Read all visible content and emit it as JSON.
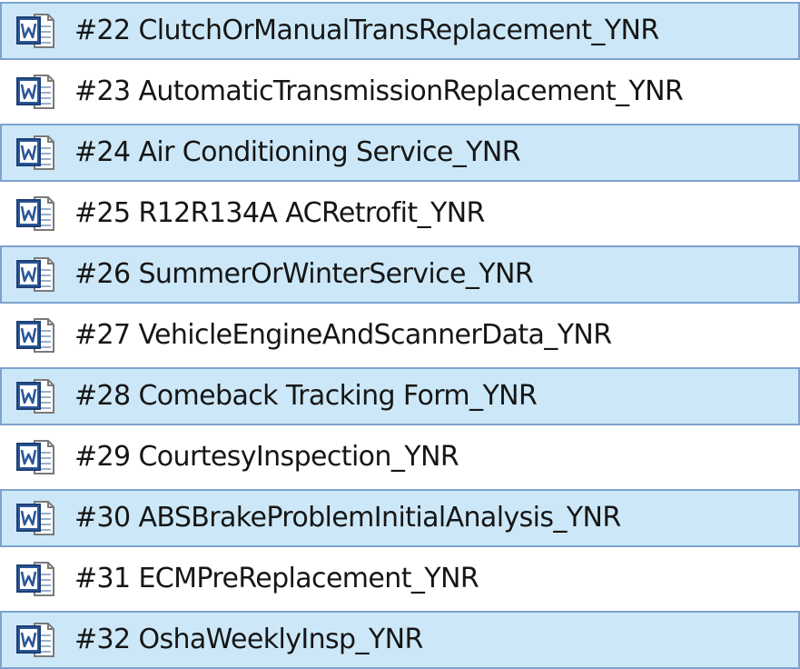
{
  "files": [
    {
      "name": "#22 ClutchOrManualTransReplacement_YNR",
      "selected": true,
      "icon": "word-document-icon"
    },
    {
      "name": "#23 AutomaticTransmissionReplacement_YNR",
      "selected": false,
      "icon": "word-document-icon"
    },
    {
      "name": "#24 Air Conditioning Service_YNR",
      "selected": true,
      "icon": "word-document-icon"
    },
    {
      "name": "#25 R12R134A ACRetrofit_YNR",
      "selected": false,
      "icon": "word-document-icon"
    },
    {
      "name": "#26 SummerOrWinterService_YNR",
      "selected": true,
      "icon": "word-document-icon"
    },
    {
      "name": "#27 VehicleEngineAndScannerData_YNR",
      "selected": false,
      "icon": "word-document-icon"
    },
    {
      "name": "#28 Comeback Tracking Form_YNR",
      "selected": true,
      "icon": "word-document-icon"
    },
    {
      "name": "#29 CourtesyInspection_YNR",
      "selected": false,
      "icon": "word-document-icon"
    },
    {
      "name": "#30 ABSBrakeProblemInitialAnalysis_YNR",
      "selected": true,
      "icon": "word-document-icon"
    },
    {
      "name": "#31 ECMPreReplacement_YNR",
      "selected": false,
      "icon": "word-document-icon"
    },
    {
      "name": "#32 OshaWeeklyInsp_YNR",
      "selected": true,
      "icon": "word-document-icon"
    }
  ],
  "colors": {
    "selected_background": "#cce8f8",
    "selected_border": "#7da2ce",
    "text": "#161616",
    "icon_blue": "#2b579a"
  }
}
